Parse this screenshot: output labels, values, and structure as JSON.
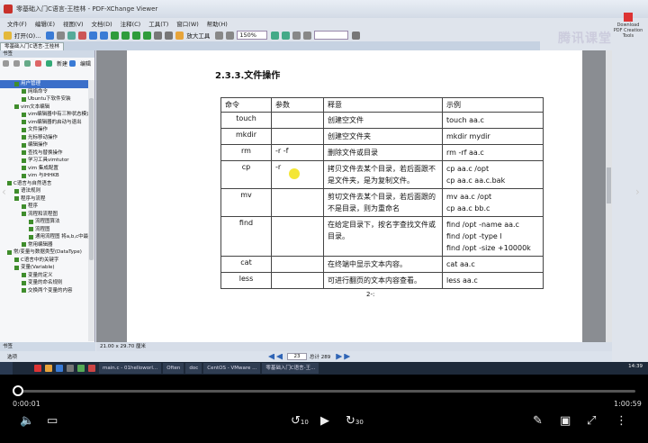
{
  "window": {
    "title": "零基础入门C语言-王桂林 - PDF-XChange Viewer",
    "logo_text": "Download PDF Creation Tools"
  },
  "menu": [
    "文件(F)",
    "编辑(E)",
    "视图(V)",
    "文档(D)",
    "注释(C)",
    "工具(T)",
    "窗口(W)",
    "帮助(H)"
  ],
  "toolbar": {
    "open_label": "打开(O)...",
    "zoom_tool_label": "放大工具",
    "zoom_value": "150%"
  },
  "tab": {
    "label": "零基础入门C语言-王桂林"
  },
  "watermark": "腾讯课堂",
  "sidebar": {
    "header": "书签",
    "new_label": "新建",
    "edit_label": "编辑",
    "bottom_label": "书签"
  },
  "outline": [
    {
      "text": "用户管理",
      "indent": 2,
      "sel": true
    },
    {
      "text": "网络命令",
      "indent": 3
    },
    {
      "text": "Ubuntu下软件安装",
      "indent": 3
    },
    {
      "text": "vim文本编辑",
      "indent": 2
    },
    {
      "text": "vim编辑器中有三种状态模式",
      "indent": 3
    },
    {
      "text": "vim编辑器的启动与退出",
      "indent": 3
    },
    {
      "text": "文件操作",
      "indent": 3
    },
    {
      "text": "光标移动操作",
      "indent": 3
    },
    {
      "text": "编辑操作",
      "indent": 3
    },
    {
      "text": "查找与替换操作",
      "indent": 3
    },
    {
      "text": "学习工具vimtutor",
      "indent": 3
    },
    {
      "text": "vim 集成配置",
      "indent": 3
    },
    {
      "text": "vim 与IHHKB",
      "indent": 3
    },
    {
      "text": "C语言与自然语言",
      "indent": 1
    },
    {
      "text": "语法规则",
      "indent": 2
    },
    {
      "text": "程序与流程",
      "indent": 2
    },
    {
      "text": "程序",
      "indent": 3
    },
    {
      "text": "流程和流程图",
      "indent": 3
    },
    {
      "text": "流程图算法",
      "indent": 4
    },
    {
      "text": "流程图",
      "indent": 4
    },
    {
      "text": "通用流程图 将a,b,c中最大值放到max中并输出",
      "indent": 4
    },
    {
      "text": "常用编辑器",
      "indent": 3
    },
    {
      "text": "常/变量与数据类型(DataType)",
      "indent": 1
    },
    {
      "text": "C语言中的关键字",
      "indent": 2
    },
    {
      "text": "变量(Variable)",
      "indent": 2
    },
    {
      "text": "变量的定义",
      "indent": 3
    },
    {
      "text": "变量的命名规则",
      "indent": 3
    },
    {
      "text": "交换两个变量的内容",
      "indent": 3
    }
  ],
  "document": {
    "heading": "2.3.3.文件操作",
    "columns": [
      "命令",
      "参数",
      "释意",
      "示例"
    ],
    "rows": [
      {
        "cmd": "touch",
        "param": "",
        "desc": "创建空文件",
        "example": [
          "touch aa.c"
        ]
      },
      {
        "cmd": "mkdir",
        "param": "",
        "desc": "创建空文件夹",
        "example": [
          "mkdir mydir"
        ]
      },
      {
        "cmd": "rm",
        "param": "-r -f",
        "desc": "删除文件或目录",
        "example": [
          "rm -rf aa.c"
        ]
      },
      {
        "cmd": "cp",
        "param": "-r",
        "desc": "拷贝文件去某个目录，若后面跟不是文件夹，是为复制文件。",
        "example": [
          "cp  aa.c  /opt",
          "cp  aa.c  aa.c.bak"
        ]
      },
      {
        "cmd": "mv",
        "param": "",
        "desc": "剪切文件去某个目录，若后面跟的不是目录，则为重命名",
        "example": [
          "mv  aa.c  /opt",
          "cp  aa.c  bb.c"
        ]
      },
      {
        "cmd": "find",
        "param": "",
        "desc": "在给定目录下，按名字查找文件或目录。",
        "example": [
          "find /opt -name aa.c",
          "find /opt -type l",
          "find /opt -size +10000k"
        ]
      },
      {
        "cmd": "cat",
        "param": "",
        "desc": "在终端中显示文本内容。",
        "example": [
          "cat aa.c"
        ]
      },
      {
        "cmd": "less",
        "param": "",
        "desc": "可进行翻页的文本内容查看。",
        "example": [
          "less aa.c"
        ]
      }
    ],
    "page_footer": "2-:"
  },
  "status": {
    "size": "21.00 x 29.70 厘米"
  },
  "nav": {
    "label": "选项",
    "current_page": "23",
    "of_label": "总计 289"
  },
  "taskbar": {
    "tasks": [
      "main.c - 01helloworl...",
      "Often",
      "doc",
      "CentOS - VMware ...",
      "零基础入门C语言-王..."
    ],
    "time": "14:39"
  },
  "player": {
    "current": "0:00:01",
    "total": "1:00:59",
    "progress": 0.0003
  }
}
